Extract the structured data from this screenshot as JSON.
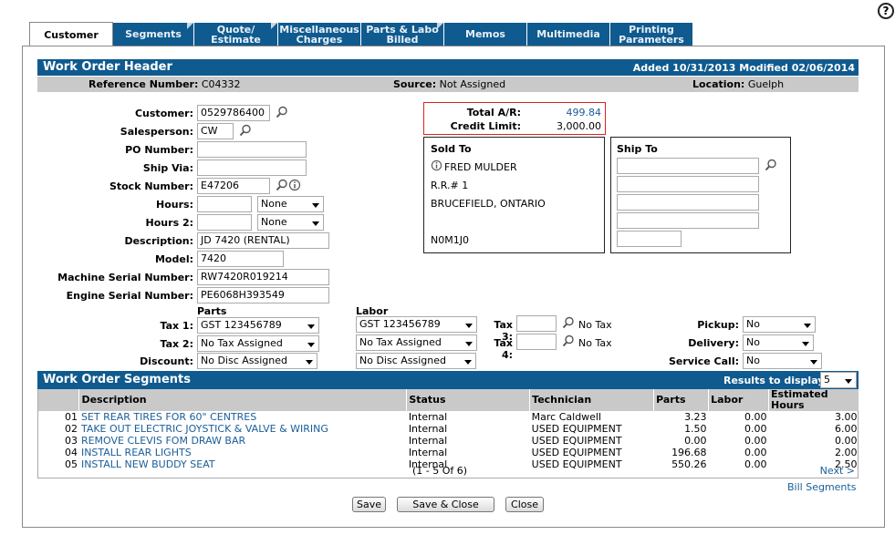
{
  "tabs": [
    {
      "label": "Customer"
    },
    {
      "label": "Segments"
    },
    {
      "label": "Quote/\nEstimate"
    },
    {
      "label": "Miscellaneous\nCharges"
    },
    {
      "label": "Parts & Labo\nBilled"
    },
    {
      "label": "Memos"
    },
    {
      "label": "Multimedia"
    },
    {
      "label": "Printing\nParameters"
    }
  ],
  "header": {
    "title": "Work Order Header",
    "dates": "Added 10/31/2013 Modified 02/06/2014"
  },
  "refbar": {
    "ref_label": "Reference Number:",
    "ref_value": "C04332",
    "source_label": "Source:",
    "source_value": "Not Assigned",
    "location_label": "Location:",
    "location_value": "Guelph"
  },
  "form": {
    "customer_label": "Customer:",
    "customer": "0529786400",
    "salesperson_label": "Salesperson:",
    "salesperson": "CW",
    "po_label": "PO Number:",
    "po": "",
    "shipvia_label": "Ship Via:",
    "shipvia": "",
    "stock_label": "Stock Number:",
    "stock": "E47206",
    "hours_label": "Hours:",
    "hours": "",
    "hours_unit": "None",
    "hours2_label": "Hours 2:",
    "hours2": "",
    "hours2_unit": "None",
    "desc_label": "Description:",
    "desc": "JD 7420 (RENTAL)",
    "model_label": "Model:",
    "model": "7420",
    "mserial_label": "Machine Serial Number:",
    "mserial": "RW7420R019214",
    "eserial_label": "Engine Serial Number:",
    "eserial": "PE6068H393549"
  },
  "ar": {
    "total_label": "Total A/R:",
    "total": "499.84",
    "credit_label": "Credit Limit:",
    "credit": "3,000.00"
  },
  "soldto": {
    "title": "Sold To",
    "name": "FRED MULDER",
    "line1": "R.R.# 1",
    "line2": "BRUCEFIELD, ONTARIO",
    "postal": "N0M1J0"
  },
  "shipto": {
    "title": "Ship To"
  },
  "tax": {
    "parts_heading": "Parts",
    "labor_heading": "Labor",
    "tax1_label": "Tax 1:",
    "tax1_parts": "GST 123456789",
    "tax1_labor": "GST 123456789",
    "tax2_label": "Tax 2:",
    "tax2_parts": "No Tax Assigned",
    "tax2_labor": "No Tax Assigned",
    "disc_label": "Discount:",
    "disc_parts": "No Disc Assigned",
    "disc_labor": "No Disc Assigned",
    "tax3_label": "Tax 3:",
    "tax3_note": "No Tax",
    "tax4_label": "Tax 4:",
    "tax4_note": "No Tax",
    "pickup_label": "Pickup:",
    "pickup": "No",
    "delivery_label": "Delivery:",
    "delivery": "No",
    "service_label": "Service Call:",
    "service": "No"
  },
  "segments": {
    "title": "Work Order Segments",
    "results_label": "Results to display:",
    "results": "5",
    "columns": [
      "Description",
      "Status",
      "Technician",
      "Parts",
      "Labor",
      "Estimated Hours"
    ],
    "rows": [
      {
        "num": "01",
        "desc": "SET REAR TIRES FOR 60\" CENTRES",
        "status": "Internal",
        "tech": "Marc Caldwell",
        "parts": "3.23",
        "labor": "0.00",
        "hours": "3.00"
      },
      {
        "num": "02",
        "desc": "TAKE OUT ELECTRIC JOYSTICK & VALVE & WIRING",
        "status": "Internal",
        "tech": "USED EQUIPMENT",
        "parts": "1.50",
        "labor": "0.00",
        "hours": "6.00"
      },
      {
        "num": "03",
        "desc": "REMOVE CLEVIS FOM DRAW BAR",
        "status": "Internal",
        "tech": "USED EQUIPMENT",
        "parts": "0.00",
        "labor": "0.00",
        "hours": "0.00"
      },
      {
        "num": "04",
        "desc": "INSTALL REAR LIGHTS",
        "status": "Internal",
        "tech": "USED EQUIPMENT",
        "parts": "196.68",
        "labor": "0.00",
        "hours": "2.00"
      },
      {
        "num": "05",
        "desc": "INSTALL NEW BUDDY SEAT",
        "status": "Internal",
        "tech": "USED EQUIPMENT",
        "parts": "550.26",
        "labor": "0.00",
        "hours": "2.50"
      }
    ],
    "pager": "(1  -  5  Of  6)",
    "next": "Next >",
    "bill": "Bill Segments"
  },
  "buttons": {
    "save": "Save",
    "save_close": "Save & Close",
    "close": "Close"
  }
}
